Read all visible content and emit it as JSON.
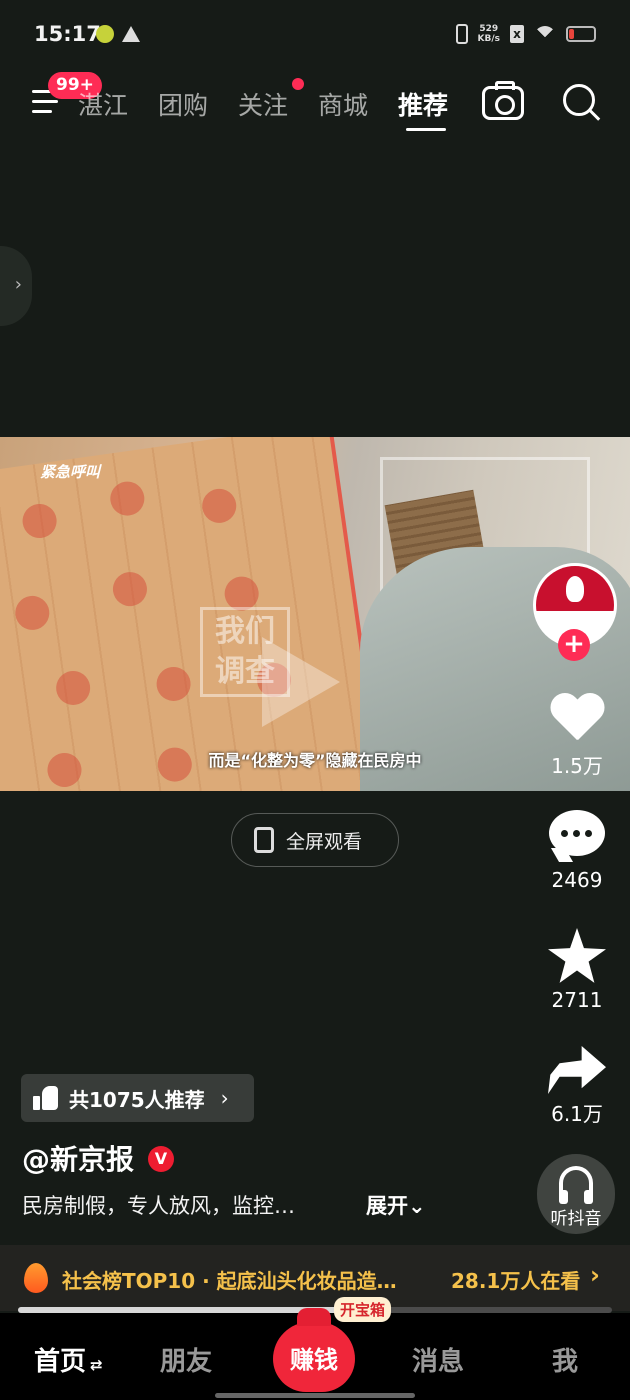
{
  "status_bar": {
    "time": "15:17",
    "net_speed_value": "529",
    "net_speed_unit": "KB/s",
    "battery_level": 0.2,
    "battery_color": "#e8453c"
  },
  "top_nav": {
    "menu_badge": "99+",
    "tabs": [
      "湛江",
      "团购",
      "关注",
      "商城",
      "推荐"
    ],
    "active_tab": "推荐",
    "icons": [
      "menu-icon",
      "camera-icon",
      "search-icon"
    ]
  },
  "video": {
    "channel_logo": "紧急呼叫",
    "watermark": "我们调查",
    "subtitle": "而是“化整为零”隐藏在民房中"
  },
  "actions": {
    "like_count": "1.5万",
    "comment_count": "2469",
    "favorite_count": "2711",
    "share_count": "6.1万",
    "listen_label": "听抖音"
  },
  "fullscreen": {
    "label": "全屏观看"
  },
  "recommend": {
    "text": "共1075人推荐"
  },
  "post": {
    "author": "@新京报",
    "verified_mark": "V",
    "description": "民房制假，专人放风，监控…",
    "expand_label": "展开"
  },
  "hot_bar": {
    "text": "社会榜TOP10 · 起底汕头化妆品造…",
    "viewers": "28.1万人在看"
  },
  "progress": {
    "played_fraction": 0.55
  },
  "bottom_nav": {
    "home": "首页",
    "friends": "朋友",
    "earn": "赚钱",
    "treasure": "开宝箱",
    "messages": "消息",
    "me": "我"
  },
  "colors": {
    "background": "#161b17",
    "accent": "#fe2c55",
    "hot_text": "#f5c14b"
  }
}
